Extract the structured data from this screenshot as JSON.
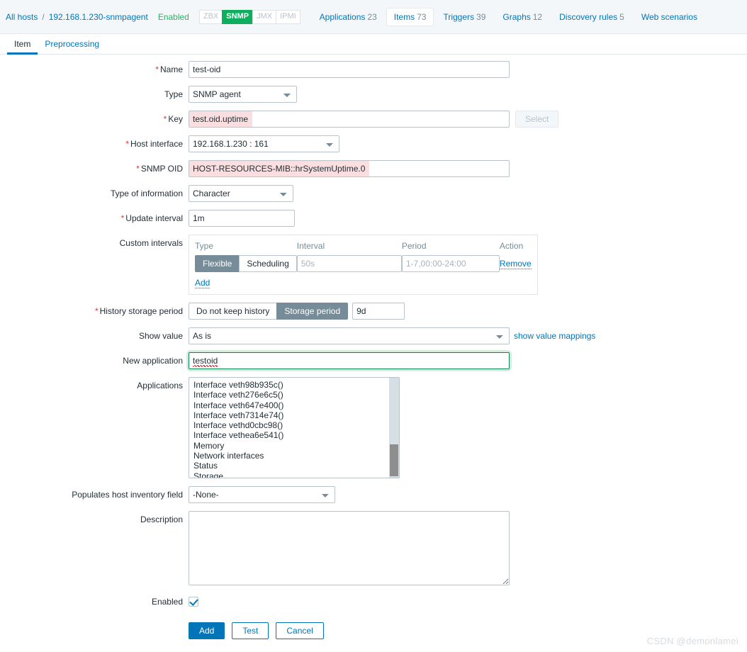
{
  "header": {
    "all_hosts_link": "All hosts",
    "separator": "/",
    "host_name": "192.168.1.230-snmpagent",
    "status": "Enabled",
    "interfaces": [
      {
        "label": "ZBX",
        "active": false
      },
      {
        "label": "SNMP",
        "active": true
      },
      {
        "label": "JMX",
        "active": false
      },
      {
        "label": "IPMI",
        "active": false
      }
    ],
    "nav_tabs": [
      {
        "label": "Applications",
        "count": "23",
        "selected": false
      },
      {
        "label": "Items",
        "count": "73",
        "selected": true
      },
      {
        "label": "Triggers",
        "count": "39",
        "selected": false
      },
      {
        "label": "Graphs",
        "count": "12",
        "selected": false
      },
      {
        "label": "Discovery rules",
        "count": "5",
        "selected": false
      },
      {
        "label": "Web scenarios",
        "count": "",
        "selected": false
      }
    ]
  },
  "form_tabs": [
    {
      "label": "Item",
      "active": true
    },
    {
      "label": "Preprocessing",
      "active": false
    }
  ],
  "form": {
    "name": {
      "label": "Name",
      "required": true,
      "value": "test-oid"
    },
    "type": {
      "label": "Type",
      "required": false,
      "value": "SNMP agent"
    },
    "key": {
      "label": "Key",
      "required": true,
      "value": "test.oid.uptime",
      "select_button": "Select"
    },
    "host_interface": {
      "label": "Host interface",
      "required": true,
      "value": "192.168.1.230 : 161"
    },
    "snmp_oid": {
      "label": "SNMP OID",
      "required": true,
      "value": "HOST-RESOURCES-MIB::hrSystemUptime.0"
    },
    "type_of_information": {
      "label": "Type of information",
      "required": false,
      "value": "Character"
    },
    "update_interval": {
      "label": "Update interval",
      "required": true,
      "value": "1m"
    },
    "custom_intervals": {
      "label": "Custom intervals",
      "columns": [
        "Type",
        "Interval",
        "Period",
        "Action"
      ],
      "rows": [
        {
          "type_flexible": "Flexible",
          "type_scheduling": "Scheduling",
          "type_selected": "Flexible",
          "interval_value": "",
          "interval_placeholder": "50s",
          "period_value": "",
          "period_placeholder": "1-7,00:00-24:00",
          "action": "Remove"
        }
      ],
      "add_link": "Add"
    },
    "history_storage_period": {
      "label": "History storage period",
      "required": true,
      "option_off": "Do not keep history",
      "option_on": "Storage period",
      "selected": "Storage period",
      "value": "9d"
    },
    "show_value": {
      "label": "Show value",
      "value": "As is",
      "mappings_link": "show value mappings"
    },
    "new_application": {
      "label": "New application",
      "value": "testoid",
      "focused": true
    },
    "applications": {
      "label": "Applications",
      "items": [
        "Interface veth98b935c()",
        "Interface veth276e6c5()",
        "Interface veth647e400()",
        "Interface veth7314e74()",
        "Interface vethd0cbc98()",
        "Interface vethea6e541()",
        "Memory",
        "Network interfaces",
        "Status",
        "Storage"
      ]
    },
    "populates_host_inventory_field": {
      "label": "Populates host inventory field",
      "value": "-None-"
    },
    "description": {
      "label": "Description",
      "value": "",
      "placeholder": ""
    },
    "enabled": {
      "label": "Enabled",
      "checked": true
    }
  },
  "actions": {
    "add": "Add",
    "test": "Test",
    "cancel": "Cancel"
  },
  "watermark": "CSDN @demonlamei",
  "colors": {
    "accent": "#0275b8",
    "enabled_green": "#34af67",
    "snmp_badge": "#0eae5f",
    "required_red": "#e33734",
    "error_field_bg": "#fbdfe0",
    "segment_selected": "#768d99",
    "focus_green": "#0a8554"
  }
}
